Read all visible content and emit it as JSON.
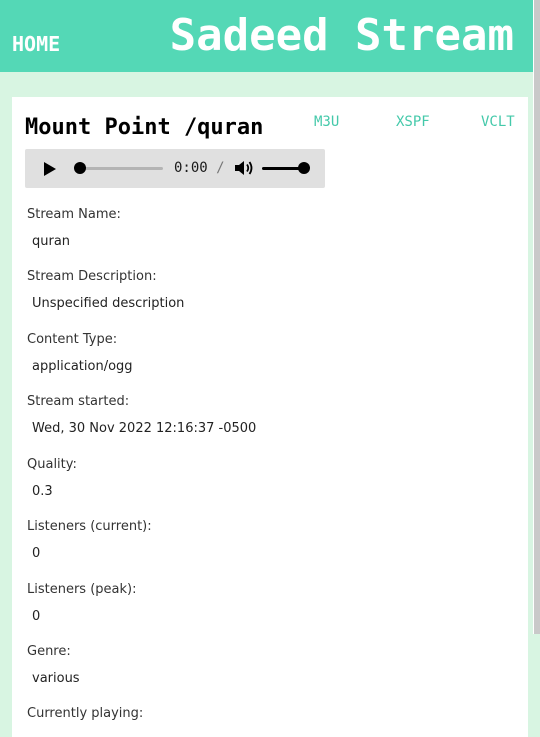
{
  "nav": {
    "home": "HOME",
    "brand": "Sadeed Stream"
  },
  "mount": {
    "title": "Mount Point /quran",
    "links": [
      "M3U",
      "XSPF",
      "VCLT"
    ]
  },
  "player": {
    "current_time": "0:00",
    "separator": "/",
    "seek_progress": 0,
    "volume_level": 1
  },
  "fields": [
    {
      "label": "Stream Name:",
      "value": "quran"
    },
    {
      "label": "Stream Description:",
      "value": "Unspecified description"
    },
    {
      "label": "Content Type:",
      "value": "application/ogg"
    },
    {
      "label": "Stream started:",
      "value": "Wed, 30 Nov 2022 12:16:37 -0500"
    },
    {
      "label": "Quality:",
      "value": "0.3"
    },
    {
      "label": "Listeners (current):",
      "value": "0"
    },
    {
      "label": "Listeners (peak):",
      "value": "0"
    },
    {
      "label": "Genre:",
      "value": "various"
    },
    {
      "label": "Currently playing:",
      "value": ""
    }
  ],
  "colors": {
    "header": "#54d8b6",
    "background": "#d8f5e2",
    "link": "#44c9aa"
  }
}
